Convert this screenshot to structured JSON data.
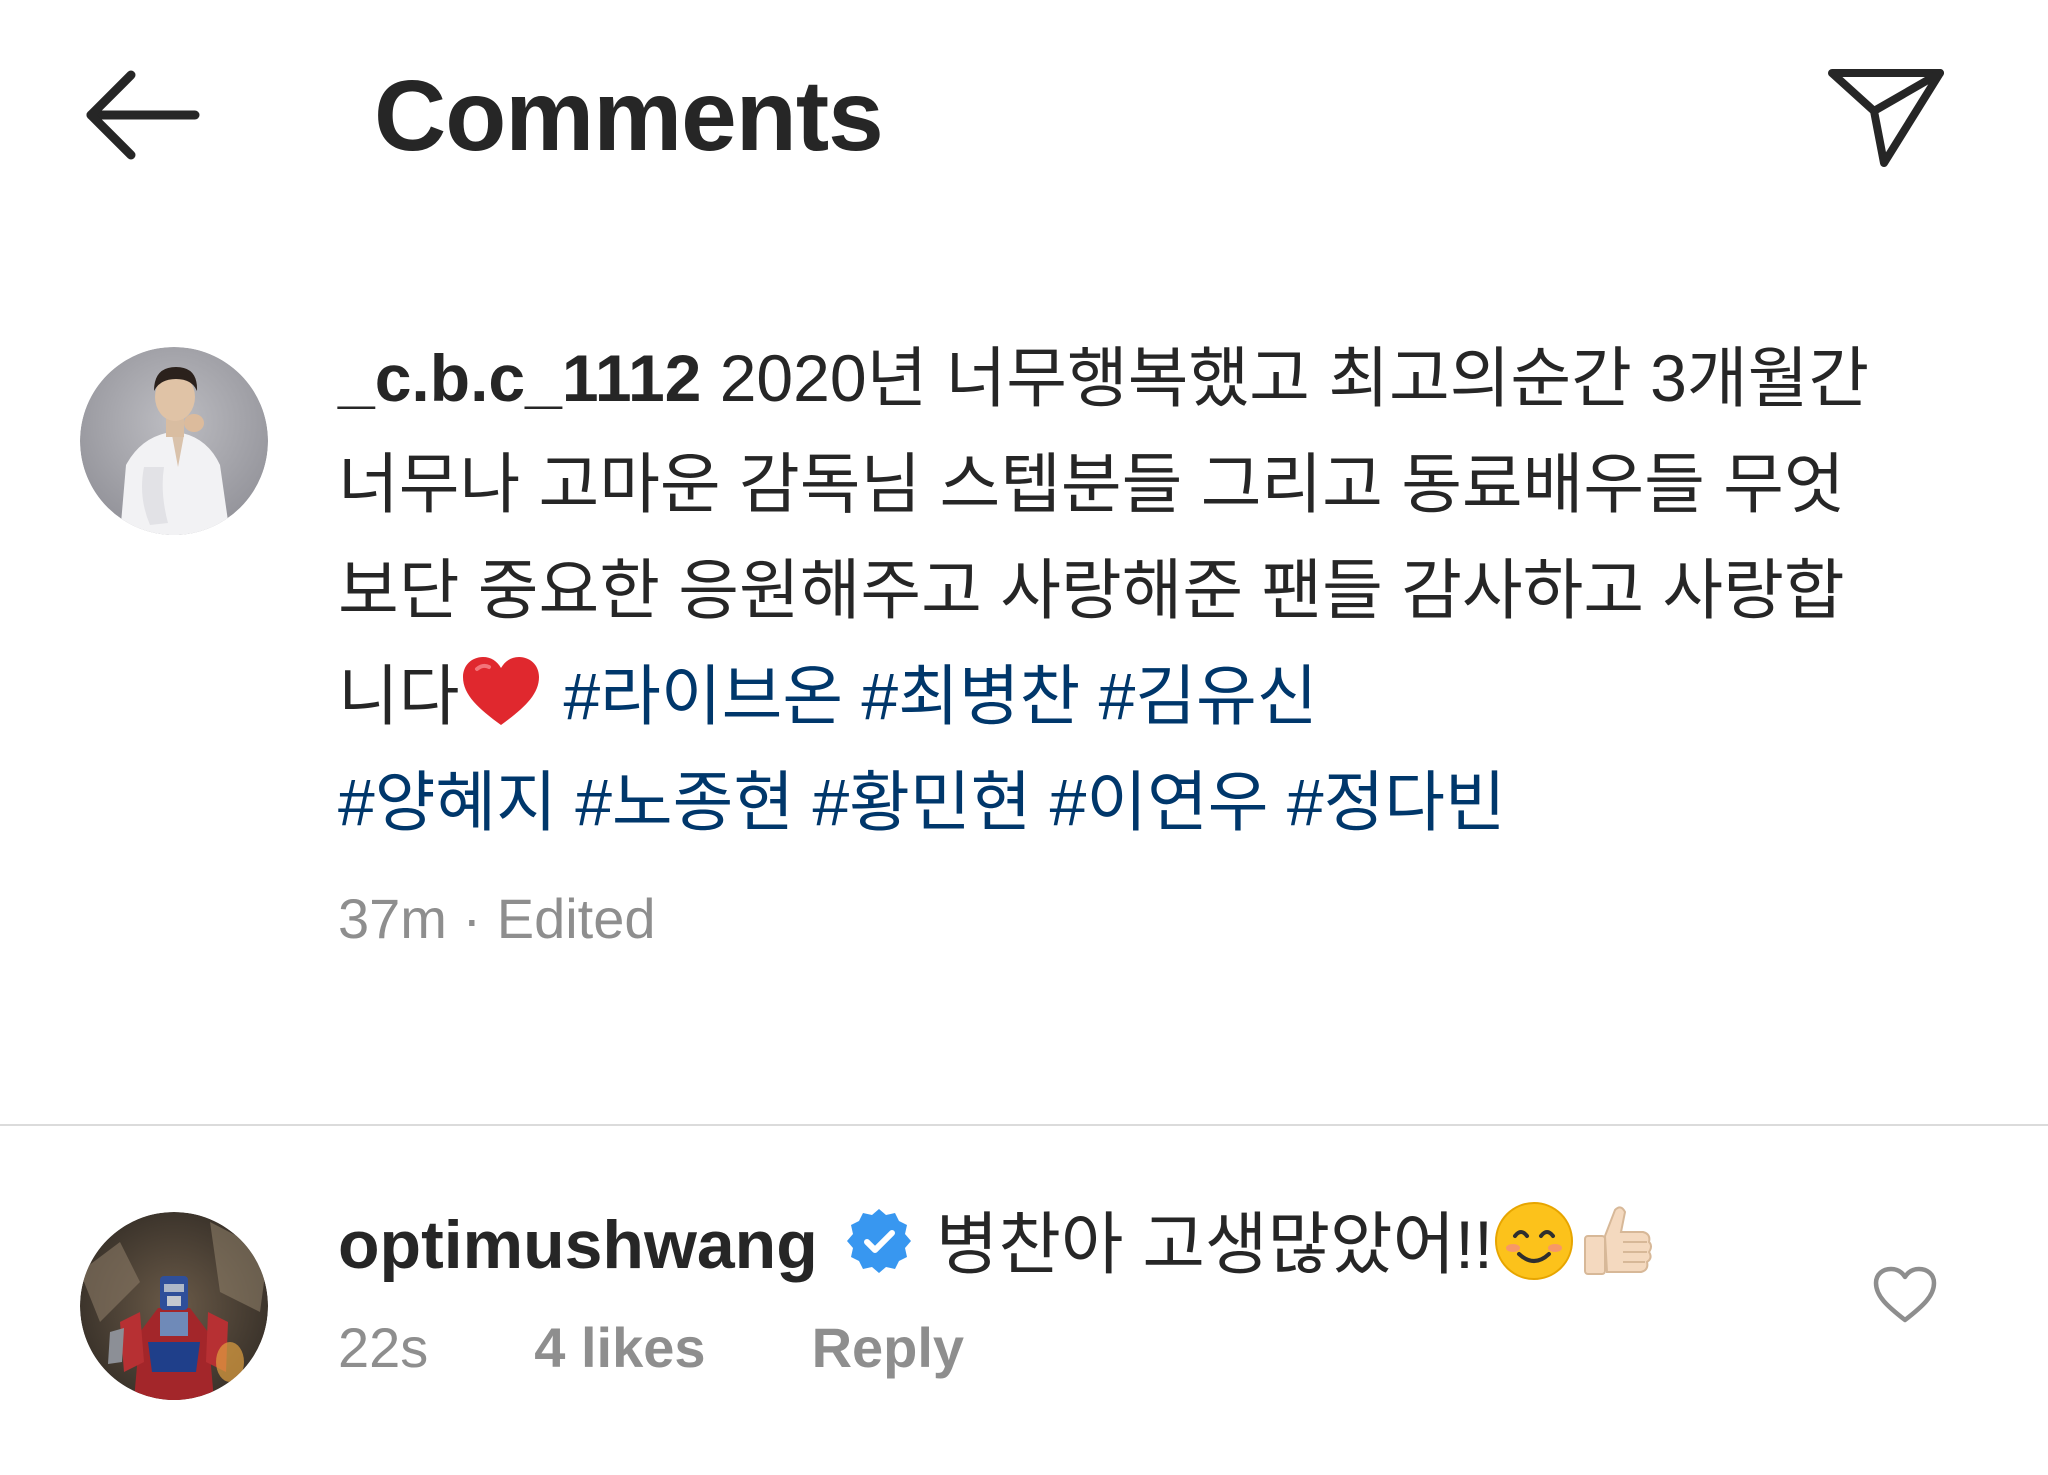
{
  "header": {
    "title": "Comments",
    "back_icon": "arrow-left-icon",
    "share_icon": "paper-plane-icon"
  },
  "caption": {
    "username": "_c.b.c_1112",
    "text": " 2020년 너무행복했고 최고의순간 3개월간 너무나 고마운 감독님 스텝분들 그리고 동료배우들 무엇보단 중요한 응원해주고 사랑해준 팬들 감사하고 사랑합니다",
    "emoji": "❤️",
    "hashtags_line1": [
      "#라이브온",
      "#최병찬",
      "#김유신"
    ],
    "hashtags_line2": [
      "#양혜지",
      "#노종현",
      "#황민현",
      "#이연우",
      "#정다빈"
    ],
    "time": "37m",
    "separator": "·",
    "edited": "Edited"
  },
  "comment": {
    "username": "optimushwang",
    "verified_icon": "verified-badge-icon",
    "text": "병찬아 고생많았어!!",
    "emojis": [
      "😊",
      "👍🏻"
    ],
    "time": "22s",
    "likes": "4 likes",
    "reply": "Reply",
    "like_icon": "heart-outline-icon"
  },
  "colors": {
    "text": "#262626",
    "hashtag": "#00376b",
    "meta": "#8e8e8e",
    "divider": "#dbdbdb",
    "verified": "#3897f0",
    "heart": "#e0282e"
  }
}
